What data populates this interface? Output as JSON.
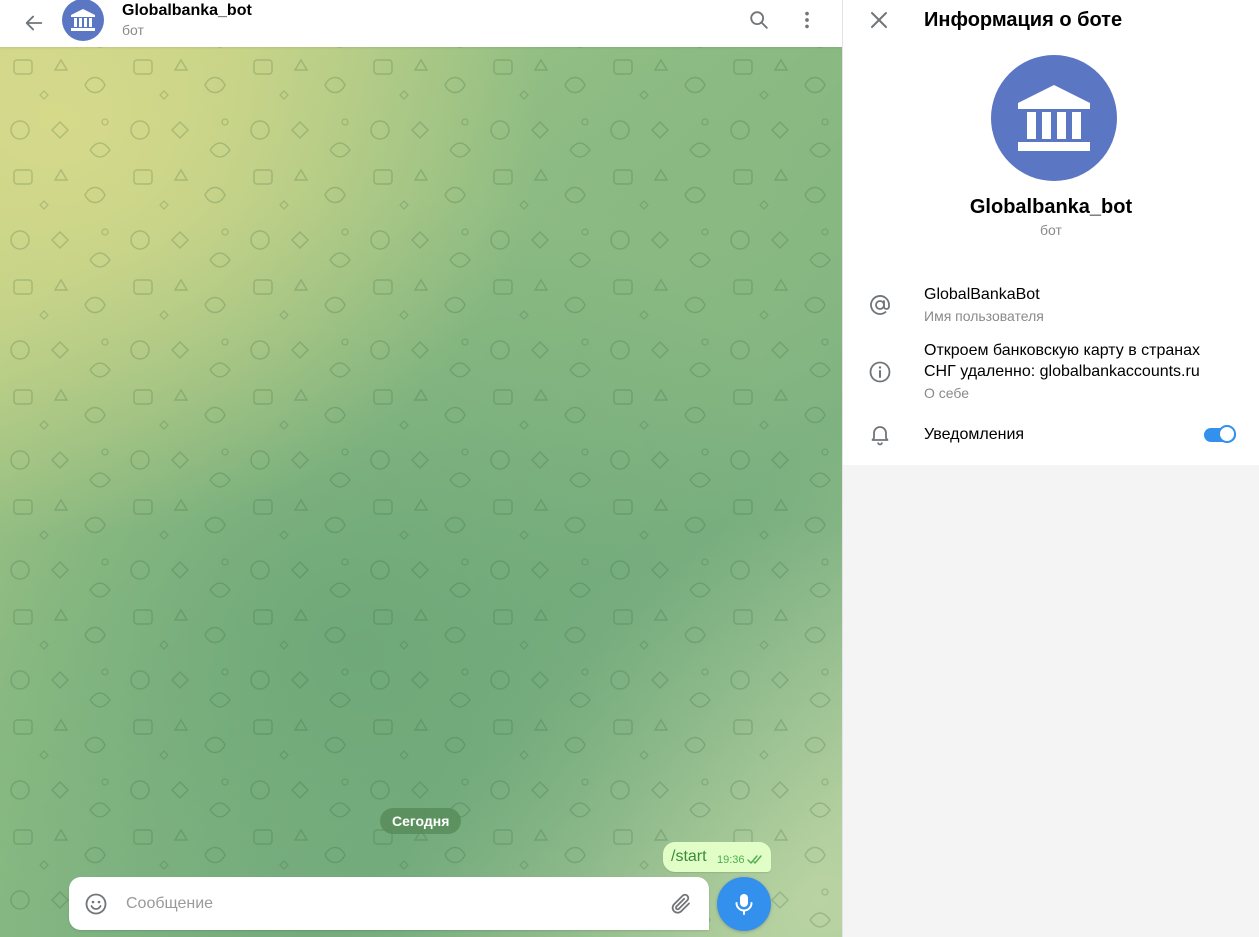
{
  "chat": {
    "title": "Globalbanka_bot",
    "subtitle": "бот",
    "date_label": "Сегодня",
    "messages": [
      {
        "text": "/start",
        "time": "19:36",
        "status": "read"
      }
    ],
    "composer": {
      "placeholder": "Сообщение"
    }
  },
  "info_panel": {
    "title": "Информация о боте",
    "name": "Globalbanka_bot",
    "subtitle": "бот",
    "username": {
      "value": "GlobalBankaBot",
      "label": "Имя пользователя"
    },
    "about": {
      "line1": "Откроем банковскую карту в странах",
      "line2": "СНГ удаленно: globalbankaccounts.ru",
      "label": "О себе"
    },
    "notifications": {
      "label": "Уведомления",
      "enabled": true
    }
  },
  "colors": {
    "accent": "#3390ec",
    "avatar": "#5b76c2",
    "outgoing_bubble": "#e1fec6"
  },
  "icons": [
    "back-arrow-icon",
    "bank-icon",
    "search-icon",
    "more-vertical-icon",
    "close-icon",
    "at-icon",
    "info-icon",
    "bell-icon",
    "emoji-icon",
    "attach-icon",
    "microphone-icon",
    "double-check-icon"
  ]
}
